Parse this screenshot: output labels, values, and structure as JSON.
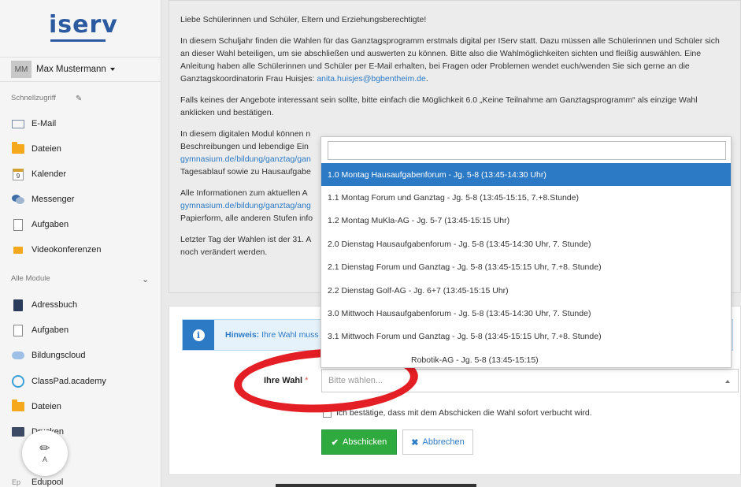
{
  "sidebar": {
    "logo": "iserv",
    "user": {
      "initials": "MM",
      "name": "Max Mustermann"
    },
    "quick_access_label": "Schnellzugriff",
    "quick_items": [
      {
        "label": "E-Mail",
        "icon": "mail-icon"
      },
      {
        "label": "Dateien",
        "icon": "folder-icon"
      },
      {
        "label": "Kalender",
        "icon": "calendar-icon",
        "day": "9"
      },
      {
        "label": "Messenger",
        "icon": "messenger-icon"
      },
      {
        "label": "Aufgaben",
        "icon": "document-icon"
      },
      {
        "label": "Videokonferenzen",
        "icon": "video-icon"
      }
    ],
    "modules_label": "Alle Module",
    "module_items": [
      {
        "label": "Adressbuch",
        "icon": "address-book-icon"
      },
      {
        "label": "Aufgaben",
        "icon": "document-icon"
      },
      {
        "label": "Bildungscloud",
        "icon": "cloud-icon"
      },
      {
        "label": "ClassPad.academy",
        "icon": "link-icon"
      },
      {
        "label": "Dateien",
        "icon": "folder-icon"
      },
      {
        "label": "Drucken",
        "icon": "printer-icon"
      },
      {
        "label": "Edupool",
        "icon": "edupool-icon",
        "badge": "Ep"
      }
    ],
    "fab_label": "A"
  },
  "info": {
    "greeting": "Liebe Schülerinnen und Schüler, Eltern und Erziehungsberechtigte!",
    "p1": "In diesem Schuljahr finden die Wahlen für das Ganztagsprogramm erstmals digital per IServ statt. Dazu müssen alle Schülerinnen und Schüler sich an dieser Wahl beteiligen, um sie abschließen und auswerten zu können. Bitte also die Wahlmöglichkeiten sichten und fleißig auswählen. Eine Anleitung haben alle Schülerinnen und Schüler per E-Mail erhalten, bei Fragen oder Problemen wendet euch/wenden Sie sich gerne an die Ganztagskoordinatorin Frau Huisjes: ",
    "p1_link": "anita.huisjes@bgbentheim.de",
    "p1_end": ".",
    "p2": "Falls keines der Angebote interessant sein sollte, bitte einfach die Möglichkeit 6.0 „Keine Teilnahme am Ganztagsprogramm“ als einzige Wahl anklicken und bestätigen.",
    "p3_a": "In diesem digitalen Modul können n",
    "p3_b": "Beschreibungen und lebendige Ein",
    "p3_link": "gymnasium.de/bildung/ganztag/gan",
    "p3_c": "Tagesablauf sowie zu Hausaufgabe",
    "p4_a": "Alle Informationen zum aktuellen A",
    "p4_link": "gymnasium.de/bildung/ganztag/ang",
    "p4_b": "Papierform, alle anderen Stufen info",
    "p5_a": "Letzter Tag der Wahlen ist der 31. A",
    "p5_b": "noch verändert werden."
  },
  "form": {
    "hint_bold": "Hinweis:",
    "hint_text": " Ihre Wahl muss",
    "choice_label": "Ihre Wahl",
    "required_mark": "*",
    "choice_placeholder": "Bitte wählen...",
    "confirm_text": "Ich bestätige, dass mit dem Abschicken die Wahl sofort verbucht wird.",
    "submit_label": "Abschicken",
    "cancel_label": "Abbrechen"
  },
  "dropdown": {
    "options": [
      "1.0 Montag Hausaufgabenforum - Jg. 5-8 (13:45-14:30 Uhr)",
      "1.1 Montag Forum und Ganztag - Jg. 5-8 (13:45-15:15, 7.+8.Stunde)",
      "1.2 Montag MuKla-AG - Jg. 5-7 (13:45-15:15 Uhr)",
      "2.0 Dienstag Hausaufgabenforum - Jg. 5-8 (13:45-14:30 Uhr, 7. Stunde)",
      "2.1 Dienstag Forum und Ganztag - Jg. 5-8 (13:45-15:15 Uhr, 7.+8. Stunde)",
      "2.2 Dienstag Golf-AG - Jg. 6+7 (13:45-15:15 Uhr)",
      "3.0 Mittwoch Hausaufgabenforum - Jg. 5-8 (13:45-14:30 Uhr, 7. Stunde)",
      "3.1 Mittwoch Forum und Ganztag - Jg. 5-8 (13:45-15:15 Uhr, 7.+8. Stunde)",
      "Robotik-AG - Jg. 5-8 (13:45-15:15)"
    ],
    "highlighted_index": 0
  },
  "colors": {
    "accent": "#2c7ac5",
    "success": "#2eaa3f",
    "annotation": "#e31e24",
    "logo": "#2c5aa0"
  }
}
